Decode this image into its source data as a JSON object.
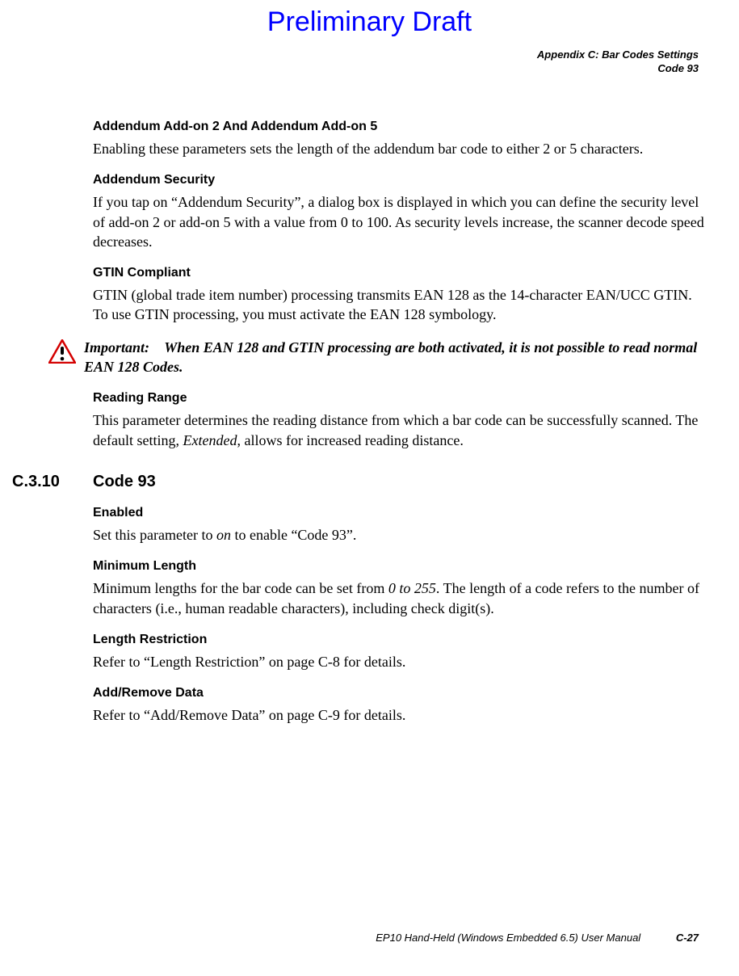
{
  "banner": "Preliminary Draft",
  "header": {
    "line1": "Appendix C: Bar Codes Settings",
    "line2": "Code 93"
  },
  "sections": {
    "addendum_addon": {
      "title": "Addendum Add-on 2 And Addendum Add-on 5",
      "body": "Enabling these parameters sets the length of the addendum bar code to either 2 or 5 characters."
    },
    "addendum_security": {
      "title": "Addendum Security",
      "body": "If you tap on “Addendum Security”, a dialog box is displayed in which you can define the security level of add-on 2 or add-on 5 with a value from 0 to 100. As security levels increase, the scanner decode speed decreases."
    },
    "gtin": {
      "title": "GTIN Compliant",
      "body": "GTIN (global trade item number) processing transmits EAN 128 as the 14-character EAN/UCC GTIN. To use GTIN processing, you must activate the EAN 128 symbology."
    },
    "important": {
      "label": "Important:",
      "body": "When EAN 128 and GTIN processing are both activated, it is not possible to read normal EAN 128 Codes."
    },
    "reading_range": {
      "title": "Reading Range",
      "body_pre": "This parameter determines the reading distance from which a bar code can be successfully scanned. The default setting, ",
      "body_italic": "Extended",
      "body_post": ", allows for increased reading distance."
    },
    "code93_section": {
      "number": "C.3.10",
      "title": "Code 93"
    },
    "enabled": {
      "title": "Enabled",
      "body_pre": "Set this parameter to ",
      "body_italic": "on",
      "body_post": " to enable “Code 93”."
    },
    "min_length": {
      "title": "Minimum Length",
      "body_pre": "Minimum lengths for the bar code can be set from ",
      "body_italic": "0 to 255",
      "body_post": ". The length of a code refers to the number of characters (i.e., human readable characters), including check digit(s)."
    },
    "length_restriction": {
      "title": "Length Restriction",
      "body": "Refer to “Length Restriction” on page C-8 for details."
    },
    "add_remove": {
      "title": "Add/Remove Data",
      "body": "Refer to “Add/Remove Data” on page C-9 for details."
    }
  },
  "footer": {
    "text": "EP10 Hand-Held (Windows Embedded 6.5) User Manual",
    "page": "C-27"
  }
}
